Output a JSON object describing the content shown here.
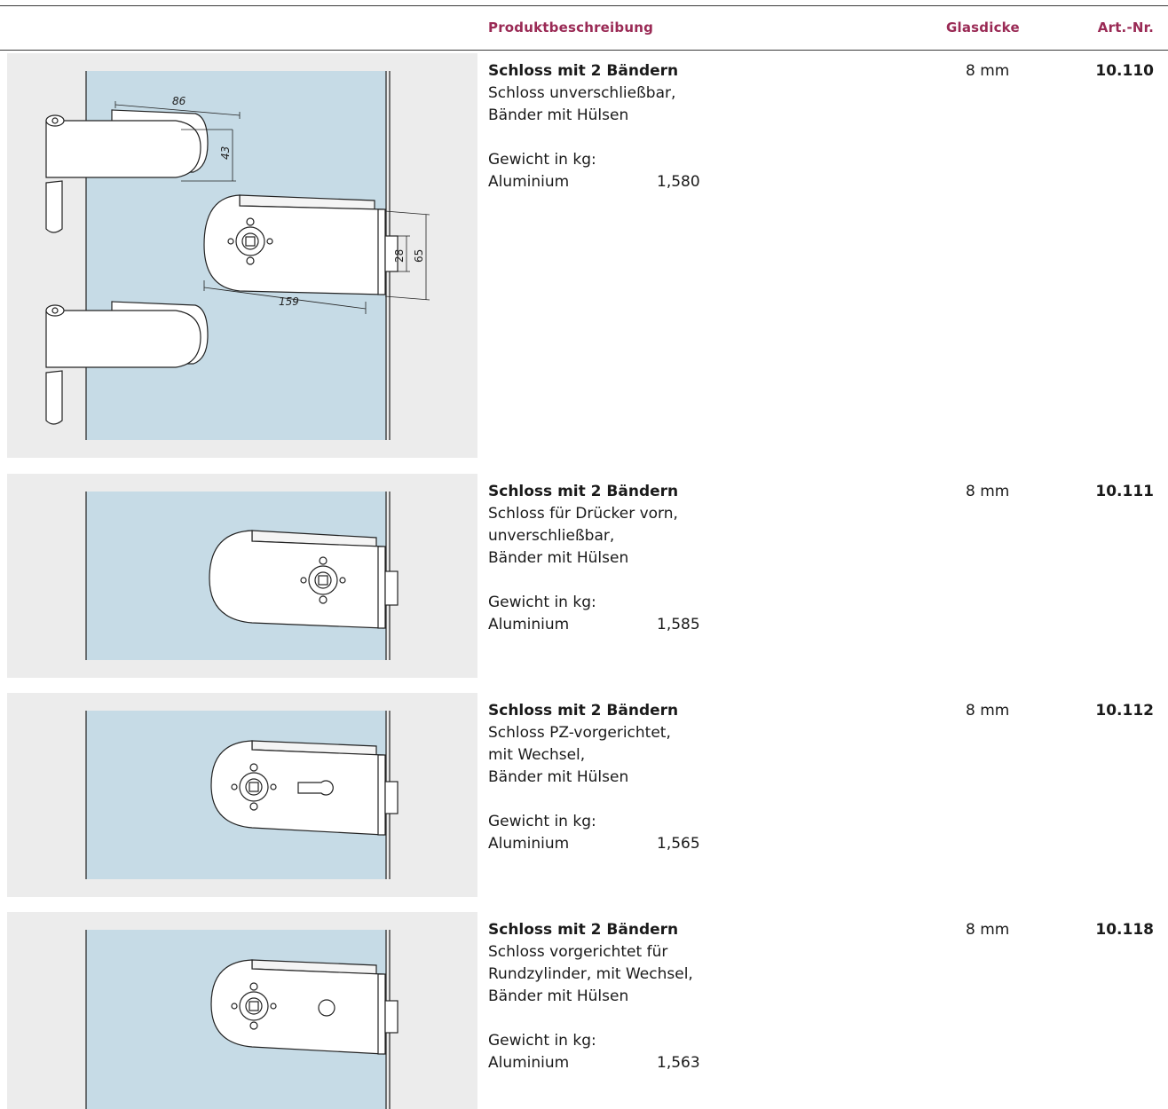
{
  "header": {
    "description": "Produktbeschreibung",
    "glass_thickness": "Glasdicke",
    "article_number": "Art.-Nr."
  },
  "products": [
    {
      "title": "Schloss mit 2 Bändern",
      "lines": [
        "Schloss unverschließbar,",
        "Bänder mit Hülsen"
      ],
      "weight_label": "Gewicht in kg:",
      "material": "Aluminium",
      "weight": "1,580",
      "glass": "8 mm",
      "art_no": "10.110",
      "dimensions": {
        "width_top": "86",
        "height_top": "43",
        "lock_length": "159",
        "strike_height": "28",
        "lock_height": "65"
      }
    },
    {
      "title": "Schloss mit 2 Bändern",
      "lines": [
        "Schloss für Drücker vorn,",
        "unverschließbar,",
        "Bänder mit Hülsen"
      ],
      "weight_label": "Gewicht in kg:",
      "material": "Aluminium",
      "weight": "1,585",
      "glass": "8 mm",
      "art_no": "10.111"
    },
    {
      "title": "Schloss mit 2 Bändern",
      "lines": [
        "Schloss PZ-vorgerichtet,",
        "mit Wechsel,",
        "Bänder mit Hülsen"
      ],
      "weight_label": "Gewicht in kg:",
      "material": "Aluminium",
      "weight": "1,565",
      "glass": "8 mm",
      "art_no": "10.112"
    },
    {
      "title": "Schloss mit 2 Bändern",
      "lines": [
        "Schloss vorgerichtet für",
        "Rundzylinder, mit Wechsel,",
        "Bänder mit Hülsen"
      ],
      "weight_label": "Gewicht in kg:",
      "material": "Aluminium",
      "weight": "1,563",
      "glass": "8 mm",
      "art_no": "10.118"
    }
  ],
  "colors": {
    "accent": "#9a2a55",
    "glass": "#c6dbe6",
    "image_bg": "#ececec"
  }
}
